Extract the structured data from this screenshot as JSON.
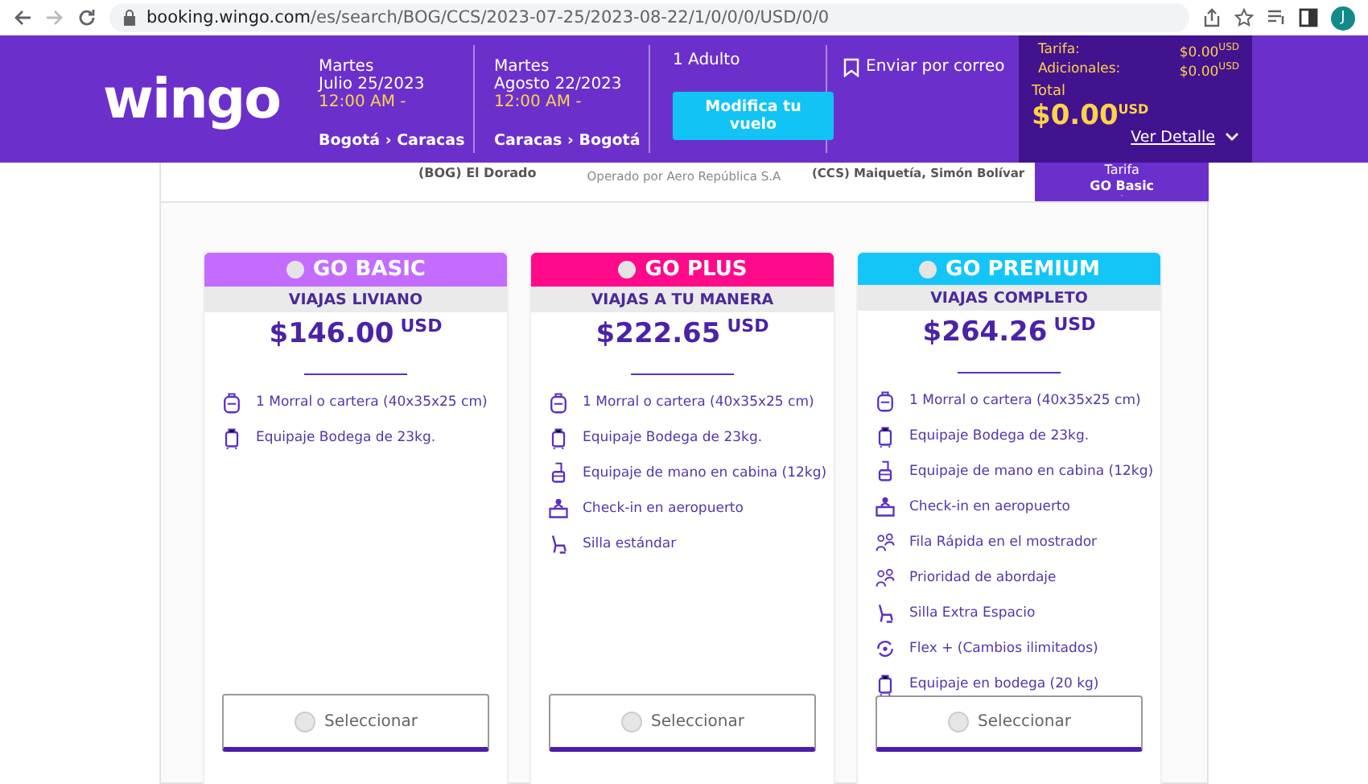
{
  "browser": {
    "url_host": "booking.wingo.com",
    "url_path": "/es/search/BOG/CCS/2023-07-25/2023-08-22/1/0/0/0/USD/0/0",
    "profile_initial": "J"
  },
  "header": {
    "logo": "wingo",
    "legs": [
      {
        "day": "Martes",
        "date": "Julio 25/2023",
        "time": "12:00 AM -",
        "route": "Bogotá › Caracas"
      },
      {
        "day": "Martes",
        "date": "Agosto 22/2023",
        "time": "12:00 AM -",
        "route": "Caracas › Bogotá"
      }
    ],
    "passengers": "1 Adulto",
    "modify_button": "Modifica tu vuelo",
    "email_link": "Enviar por correo",
    "summary": {
      "fare_label": "Tarifa:",
      "fare_value": "$0.00",
      "fare_currency": "USD",
      "extras_label": "Adicionales:",
      "extras_value": "$0.00",
      "extras_currency": "USD",
      "total_label": "Total",
      "total_value": "$0.00",
      "total_currency": "USD",
      "details_link": "Ver Detalle"
    }
  },
  "flight": {
    "origin": "(BOG) El Dorado",
    "operator": "Operado por Aero República S.A",
    "destination": "(CCS) Maiquetía, Simón Bolívar",
    "fare_tab": "Tarifa **GO Basic**"
  },
  "fares": [
    {
      "name": "GO BASIC",
      "color": "#c46cff",
      "subtitle": "VIAJAS LIVIANO",
      "price": "$146.00",
      "currency": "USD",
      "selected": false,
      "button": "Seleccionar",
      "features": [
        {
          "kind": "backpack",
          "text": "1 Morral o cartera (40x35x25 cm)"
        },
        {
          "kind": "suitcase",
          "text": "Equipaje Bodega de 23kg."
        }
      ]
    },
    {
      "name": "GO PLUS",
      "color": "#ff0a8a",
      "subtitle": "VIAJAS A TU MANERA",
      "price": "$222.65",
      "currency": "USD",
      "selected": false,
      "button": "Seleccionar",
      "features": [
        {
          "kind": "backpack",
          "text": "1 Morral o cartera (40x35x25 cm)"
        },
        {
          "kind": "suitcase",
          "text": "Equipaje Bodega de 23kg."
        },
        {
          "kind": "trolley",
          "text": "Equipaje de mano en cabina (12kg)"
        },
        {
          "kind": "counter",
          "text": "Check-in en aeropuerto"
        },
        {
          "kind": "seat",
          "text": "Silla estándar"
        }
      ]
    },
    {
      "name": "GO PREMIUM",
      "color": "#14c6f7",
      "subtitle": "VIAJAS COMPLETO",
      "price": "$264.26",
      "currency": "USD",
      "selected": false,
      "button": "Seleccionar",
      "features": [
        {
          "kind": "backpack",
          "text": "1 Morral o cartera (40x35x25 cm)"
        },
        {
          "kind": "suitcase",
          "text": "Equipaje Bodega de 23kg."
        },
        {
          "kind": "trolley",
          "text": "Equipaje de mano en cabina (12kg)"
        },
        {
          "kind": "counter",
          "text": "Check-in en aeropuerto"
        },
        {
          "kind": "people",
          "text": "Fila Rápida en el mostrador"
        },
        {
          "kind": "people",
          "text": "Prioridad de abordaje"
        },
        {
          "kind": "seat",
          "text": "Silla Extra Espacio"
        },
        {
          "kind": "cycle",
          "text": "Flex + (Cambios ilimitados)"
        },
        {
          "kind": "suitcase",
          "text": "Equipaje en bodega (20 kg)"
        }
      ]
    }
  ]
}
